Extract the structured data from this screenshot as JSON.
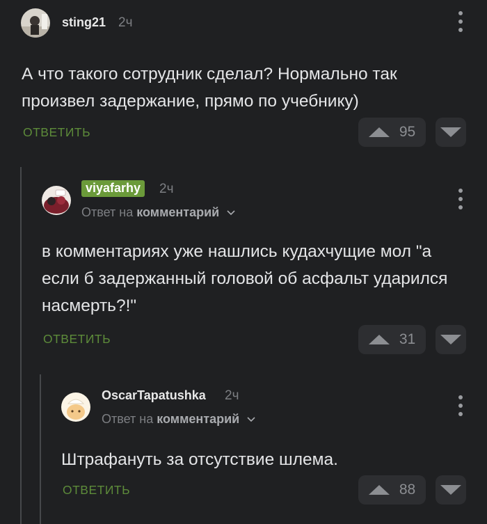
{
  "colors": {
    "background": "#1f2022",
    "accent_green": "#5d8b3a",
    "badge_green": "#6b9a3a"
  },
  "comments": [
    {
      "author": "sting21",
      "time": "2ч",
      "text": "А что такого сотрудник сделал? Нормально так произвел задержание, прямо по учебнику)",
      "reply_label": "ОТВЕТИТЬ",
      "rating": "95",
      "avatar_icon": "user-avatar-photo"
    },
    {
      "author": "viyafarhy",
      "time": "2ч",
      "reply_prefix": "Ответ на",
      "reply_link": "комментарий",
      "text": "в комментариях уже нашлись кудахчущие мол \"а если б задержанный головой об асфальт ударился насмерть?!\"",
      "reply_label": "ОТВЕТИТЬ",
      "rating": "31",
      "avatar_icon": "user-avatar-illustration"
    },
    {
      "author": "OscarTapatushka",
      "time": "2ч",
      "reply_prefix": "Ответ на",
      "reply_link": "комментарий",
      "text": "Штрафануть за отсутствие шлема.",
      "reply_label": "ОТВЕТИТЬ",
      "rating": "88",
      "avatar_icon": "user-avatar-cartoon"
    }
  ]
}
